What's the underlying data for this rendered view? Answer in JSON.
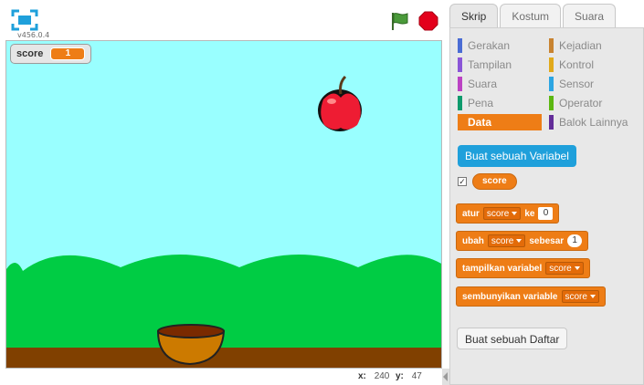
{
  "stage": {
    "version": "v456.0.4",
    "monitor": {
      "label": "score",
      "value": "1"
    },
    "coords": {
      "x_label": "x:",
      "x_value": "240",
      "y_label": "y:",
      "y_value": "47"
    }
  },
  "tabs": [
    {
      "label": "Skrip",
      "active": true
    },
    {
      "label": "Kostum",
      "active": false
    },
    {
      "label": "Suara",
      "active": false
    }
  ],
  "categories": {
    "left": [
      {
        "label": "Gerakan",
        "color": "#4a6cd4"
      },
      {
        "label": "Tampilan",
        "color": "#8a55d7"
      },
      {
        "label": "Suara",
        "color": "#bb42c3"
      },
      {
        "label": "Pena",
        "color": "#0e9a6c"
      },
      {
        "label": "Data",
        "color": "#ee7d16",
        "active": true
      }
    ],
    "right": [
      {
        "label": "Kejadian",
        "color": "#c88330"
      },
      {
        "label": "Kontrol",
        "color": "#e1a91a"
      },
      {
        "label": "Sensor",
        "color": "#2ca5e2"
      },
      {
        "label": "Operator",
        "color": "#5cb712"
      },
      {
        "label": "Balok Lainnya",
        "color": "#632d99"
      }
    ]
  },
  "palette": {
    "make_variable": "Buat sebuah Variabel",
    "variable_reporter": "score",
    "checkbox_mark": "✓",
    "blocks": {
      "set": {
        "label": "atur",
        "var": "score",
        "to": "ke",
        "value": "0"
      },
      "change": {
        "label": "ubah",
        "var": "score",
        "by": "sebesar",
        "value": "1"
      },
      "show": {
        "label": "tampilkan variabel",
        "var": "score"
      },
      "hide": {
        "label": "sembunyikan variable",
        "var": "score"
      }
    },
    "make_list": "Buat sebuah Daftar"
  }
}
